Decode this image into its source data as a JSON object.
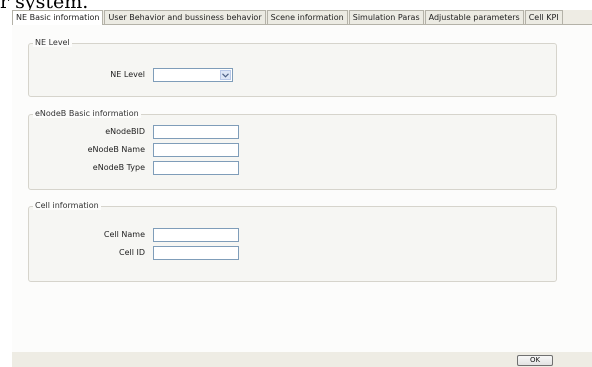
{
  "background_text": "r system.",
  "tabs": [
    {
      "label": "NE Basic information",
      "active": true
    },
    {
      "label": "User Behavior and bussiness behavior",
      "active": false
    },
    {
      "label": "Scene information",
      "active": false
    },
    {
      "label": "Simulation Paras",
      "active": false
    },
    {
      "label": "Adjustable parameters",
      "active": false
    },
    {
      "label": "Cell KPI",
      "active": false
    }
  ],
  "ne_level": {
    "legend": "NE Level",
    "label": "NE Level",
    "value": ""
  },
  "enodeb": {
    "legend": "eNodeB Basic information",
    "fields": [
      {
        "label": "eNodeBID",
        "value": ""
      },
      {
        "label": "eNodeB Name",
        "value": ""
      },
      {
        "label": "eNodeB Type",
        "value": ""
      }
    ]
  },
  "cell": {
    "legend": "Cell information",
    "fields": [
      {
        "label": "Cell Name",
        "value": ""
      },
      {
        "label": "Cell ID",
        "value": ""
      }
    ]
  },
  "buttons": {
    "ok": "OK"
  },
  "icons": {
    "dropdown": "chevron-down-icon"
  },
  "colors": {
    "field_border": "#7f9db9",
    "window_bg": "#eeece4"
  }
}
